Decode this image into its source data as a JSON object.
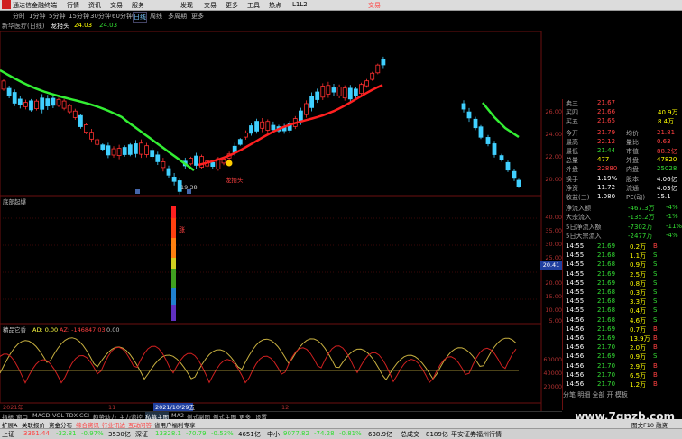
{
  "topbar": {
    "app_title": "通达信金融终端",
    "menus": [
      "行情",
      "资讯",
      "交易",
      "服务"
    ],
    "right_menus": [
      "发现",
      "交易",
      "更多",
      "工具",
      "热点",
      "L1L2"
    ],
    "right_btn": "交易"
  },
  "timeframes": [
    "分时",
    "1分钟",
    "5分钟",
    "15分钟",
    "30分钟",
    "60分钟",
    "日线",
    "周线",
    "多周期",
    "更多"
  ],
  "info": {
    "stock": "新华医疗(日线)",
    "ma_label": "龙抬头",
    "ma_value": "24.03",
    "ma_value2": "24.03"
  },
  "kline": {
    "price_labels": [
      "26.00",
      "24.00",
      "22.00",
      "20.00"
    ],
    "low_mark": "19.38",
    "annotation": "龙抬头"
  },
  "pane2": {
    "title": "底部起爆",
    "labels": [
      "40.00",
      "35.00",
      "30.00",
      "25.00",
      "20.00",
      "15.00",
      "10.00",
      "5.00"
    ],
    "marker": "20.41",
    "signal": "涨"
  },
  "pane3": {
    "title": "精品它香",
    "ad_label": "AD: 0.00",
    "az_label": "AZ: -146847.03",
    "v_label": "0.00",
    "labels": [
      "60000",
      "40000",
      "20000"
    ]
  },
  "dates": {
    "d1": "2021年",
    "d2": "11",
    "d3": "2021/10/29五",
    "d4": "12"
  },
  "quote": {
    "rows1": [
      {
        "l": "卖三",
        "v": "21.67",
        "r": "",
        "rv": ""
      },
      {
        "l": "买四",
        "v": "21.66",
        "r": "",
        "rv": "40.9万"
      },
      {
        "l": "买五",
        "v": "21.65",
        "r": "",
        "rv": "8.4万"
      }
    ],
    "rows2": [
      {
        "l": "今开",
        "v": "21.79",
        "r": "均价",
        "rv": "21.81"
      },
      {
        "l": "最高",
        "v": "22.12",
        "r": "量比",
        "rv": "0.63"
      },
      {
        "l": "最低",
        "v": "21.44",
        "r": "市值",
        "rv": "88.2亿"
      },
      {
        "l": "总量",
        "v": "477",
        "r": "外盘",
        "rv": "47820"
      },
      {
        "l": "外盘",
        "v": "22880",
        "r": "内盘",
        "rv": "25028"
      }
    ],
    "rows3": [
      {
        "l": "换手",
        "v": "1.19%",
        "r": "股本",
        "rv": "4.06亿"
      },
      {
        "l": "净资",
        "v": "11.72",
        "r": "流通",
        "rv": "4.03亿"
      },
      {
        "l": "收益(三)",
        "v": "1.080",
        "r": "PE(动)",
        "rv": "15.1"
      }
    ],
    "flows": [
      {
        "l": "净流入额",
        "v": "-467.3万",
        "p": "-4%"
      },
      {
        "l": "大宗流入",
        "v": "-135.2万",
        "p": "-1%"
      },
      {
        "l": "5日净流入额",
        "v": "-7302万",
        "p": "-11%"
      },
      {
        "l": "5日大宗流入",
        "v": "-2477万",
        "p": "-4%"
      }
    ],
    "ticks": [
      {
        "t": "14:55",
        "p": "21.69",
        "v": "0.2万",
        "s": "B"
      },
      {
        "t": "14:55",
        "p": "21.68",
        "v": "1.1万",
        "s": "S"
      },
      {
        "t": "14:55",
        "p": "21.68",
        "v": "0.9万",
        "s": "S"
      },
      {
        "t": "14:55",
        "p": "21.69",
        "v": "2.5万",
        "s": "S"
      },
      {
        "t": "14:55",
        "p": "21.69",
        "v": "0.8万",
        "s": "S"
      },
      {
        "t": "14:55",
        "p": "21.68",
        "v": "0.3万",
        "s": "S"
      },
      {
        "t": "14:55",
        "p": "21.68",
        "v": "3.3万",
        "s": "S"
      },
      {
        "t": "14:55",
        "p": "21.68",
        "v": "0.4万",
        "s": "S"
      },
      {
        "t": "14:56",
        "p": "21.68",
        "v": "4.6万",
        "s": "S"
      },
      {
        "t": "14:56",
        "p": "21.69",
        "v": "0.7万",
        "s": "B"
      },
      {
        "t": "14:56",
        "p": "21.69",
        "v": "13.9万",
        "s": "B"
      },
      {
        "t": "14:56",
        "p": "21.70",
        "v": "2.0万",
        "s": "B"
      },
      {
        "t": "14:56",
        "p": "21.69",
        "v": "0.9万",
        "s": "S"
      },
      {
        "t": "14:56",
        "p": "21.70",
        "v": "2.9万",
        "s": "B"
      },
      {
        "t": "14:56",
        "p": "21.70",
        "v": "6.5万",
        "s": "B"
      },
      {
        "t": "14:56",
        "p": "21.70",
        "v": "1.2万",
        "s": "B"
      }
    ],
    "tail": "分笔 明细 全部 开 模板"
  },
  "bottomtabs": [
    "指标",
    "窗口",
    "MACD",
    "VOL-TDX",
    "CCI",
    "趋势动力",
    "主力监控",
    "私募主图",
    "MA2",
    "例式副图",
    "例式主图",
    "更多",
    "设置"
  ],
  "extbar": [
    "扩展A",
    "关联报价",
    "资金分布",
    "综合资讯",
    "行业讯达",
    "互动问答",
    "省用户福利专享"
  ],
  "ext_right": "图文F10 融资",
  "status": [
    {
      "n": "上证",
      "v": "3361.44",
      "c": "-32.81",
      "p": "-0.97%",
      "a": "3530亿"
    },
    {
      "n": "深证",
      "v": "13328.1",
      "c": "-70.79",
      "p": "-0.53%",
      "a": "4651亿"
    },
    {
      "n": "中小",
      "v": "9077.82",
      "c": "-74.28",
      "p": "-0.81%",
      "a": "638.9亿"
    }
  ],
  "status_extra": {
    "total": "总成交",
    "total_v": "8189亿",
    "broker": "平安证券福州行情"
  },
  "watermark": "www.7gpzb.com"
}
